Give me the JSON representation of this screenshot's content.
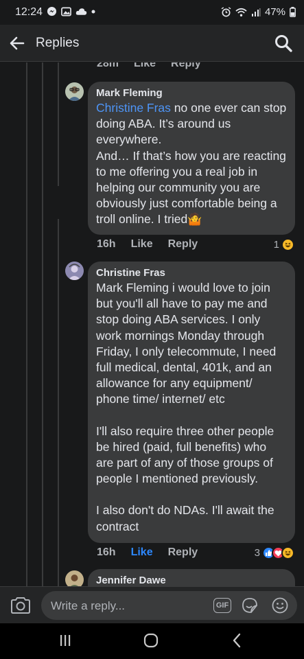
{
  "status_bar": {
    "time": "12:24",
    "battery": "47%",
    "icons_left": [
      "messenger-icon",
      "gallery-icon",
      "cloud-icon",
      "dot-icon"
    ],
    "icons_right": [
      "alarm-icon",
      "wifi-icon",
      "signal-icon",
      "battery-icon"
    ]
  },
  "header": {
    "title": "Replies"
  },
  "top_actions": {
    "time": "28m",
    "like": "Like",
    "reply": "Reply"
  },
  "comments": [
    {
      "author": "Mark Fleming",
      "mention": "Christine Fras",
      "text_after_mention": " no one ever can stop doing ABA. It’s around us everywhere.",
      "text_2": "And… If that’s how you are reacting to me offering you a real job in helping our community you are obviously just comfortable being a troll online. I tried",
      "emoji": "🤷",
      "time": "16h",
      "like": "Like",
      "reply": "Reply",
      "reaction_count": "1"
    },
    {
      "author": "Christine Fras",
      "paragraph_1": "Mark Fleming i would love to join but you'll all have to pay me and stop doing ABA services. I only work mornings Monday through Friday, I only telecommute, I need full medical, dental, 401k, and an allowance for any equipment/ phone time/ internet/ etc",
      "paragraph_2": "I'll also require three other people be hired (paid, full benefits) who are part of any of those groups of people I mentioned previously.",
      "paragraph_3": "I also don't do NDAs. I'll await the contract",
      "time": "16h",
      "like": "Like",
      "reply": "Reply",
      "reaction_count": "3"
    },
    {
      "author": "Jennifer Dawe"
    }
  ],
  "composer": {
    "placeholder": "Write a reply...",
    "gif_label": "GIF"
  },
  "colors": {
    "background": "#18191a",
    "bubble": "#3a3b3c",
    "mention": "#4e95f7",
    "like_active": "#2d88ff",
    "haha": "#f7b928",
    "love": "#f33e58"
  }
}
